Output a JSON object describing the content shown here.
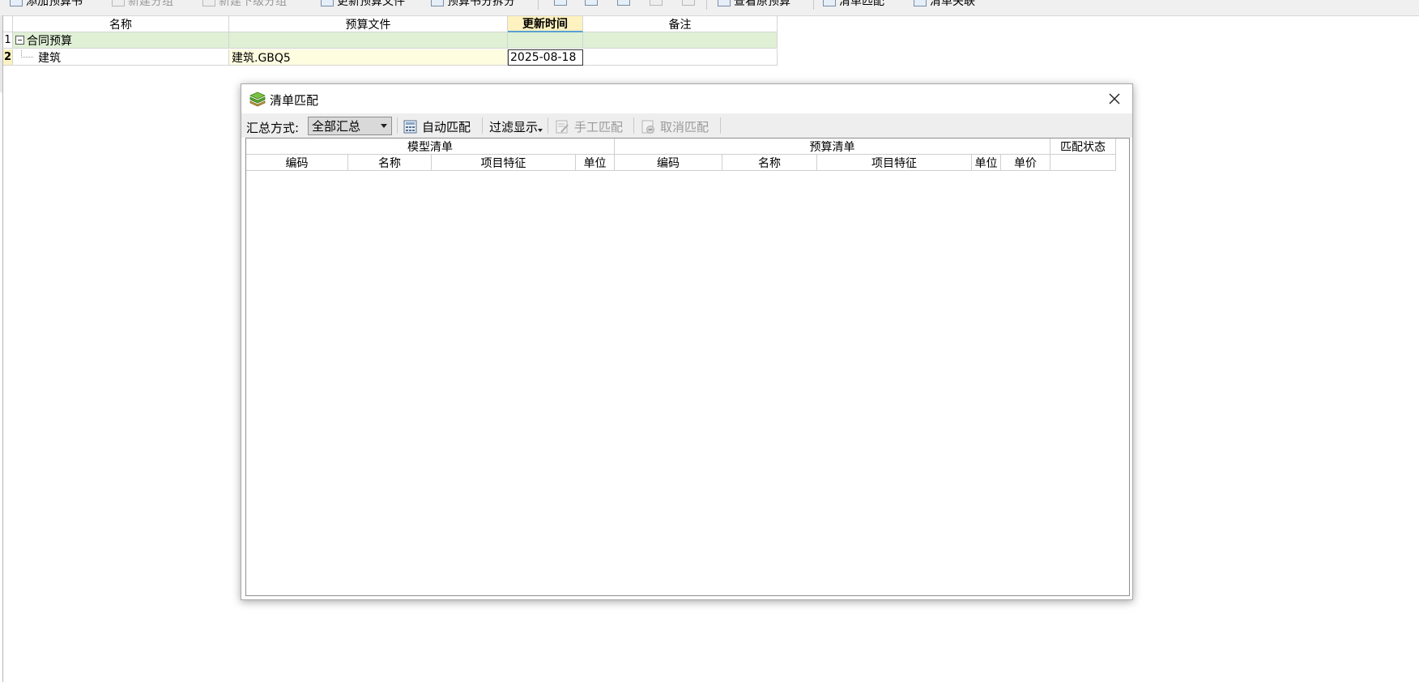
{
  "toolbar": {
    "items": [
      {
        "label": "添加预算书",
        "disabled": false
      },
      {
        "label": "新建分组",
        "disabled": true
      },
      {
        "label": "新建下级分组",
        "disabled": true
      },
      {
        "label": "更新预算文件",
        "disabled": false
      },
      {
        "label": "预算书分拆分",
        "disabled": false
      },
      {
        "label": "查看原预算",
        "disabled": false
      },
      {
        "label": "清单匹配",
        "disabled": false
      },
      {
        "label": "清单关联",
        "disabled": false
      }
    ]
  },
  "main_grid": {
    "headers": [
      "名称",
      "预算文件",
      "更新时间",
      "备注"
    ],
    "rows": [
      {
        "num": "1",
        "name": "合同预算",
        "file": "",
        "time": "",
        "note": ""
      },
      {
        "num": "2",
        "name": "建筑",
        "file": "建筑.GBQ5",
        "time": "2025-08-18",
        "note": ""
      }
    ]
  },
  "dialog": {
    "title": "清单匹配",
    "summary_label": "汇总方式:",
    "summary_value": "全部汇总",
    "buttons": {
      "auto_match": "自动匹配",
      "filter_display": "过滤显示",
      "manual_match": "手工匹配",
      "cancel_match": "取消匹配"
    },
    "table": {
      "group_model": "模型清单",
      "group_budget": "预算清单",
      "match_status": "匹配状态",
      "model_columns": [
        "编码",
        "名称",
        "项目特征",
        "单位"
      ],
      "budget_columns": [
        "编码",
        "名称",
        "项目特征",
        "单位",
        "单价"
      ]
    }
  }
}
